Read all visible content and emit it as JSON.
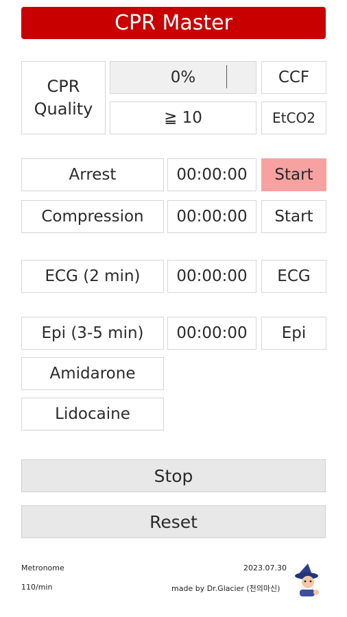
{
  "app": {
    "title": "CPR Master"
  },
  "quality": {
    "label_line1": "CPR",
    "label_line2": "Quality",
    "ccf_value": "0%",
    "ccf_button": "CCF",
    "etco2_value": "≧ 10",
    "etco2_button": "EtCO2"
  },
  "timers": [
    {
      "label": "Arrest",
      "time": "00:00:00",
      "button": "Start"
    },
    {
      "label": "Compression",
      "time": "00:00:00",
      "button": "Start"
    },
    {
      "label": "ECG (2 min)",
      "time": "00:00:00",
      "button": "ECG"
    },
    {
      "label": "Epi (3-5 min)",
      "time": "00:00:00",
      "button": "Epi"
    }
  ],
  "drugs": {
    "amidarone": "Amidarone",
    "lidocaine": "Lidocaine"
  },
  "controls": {
    "stop": "Stop",
    "reset": "Reset"
  },
  "footer": {
    "metronome_label": "Metronome",
    "metronome_rate": "110/min",
    "date": "2023.07.30",
    "credit": "made by Dr.Glacier (천의마신)"
  },
  "colors": {
    "title_bg": "#c80000",
    "start_active": "#f7a1a1"
  },
  "icons": {
    "mascot": "wizard-mascot-icon"
  }
}
